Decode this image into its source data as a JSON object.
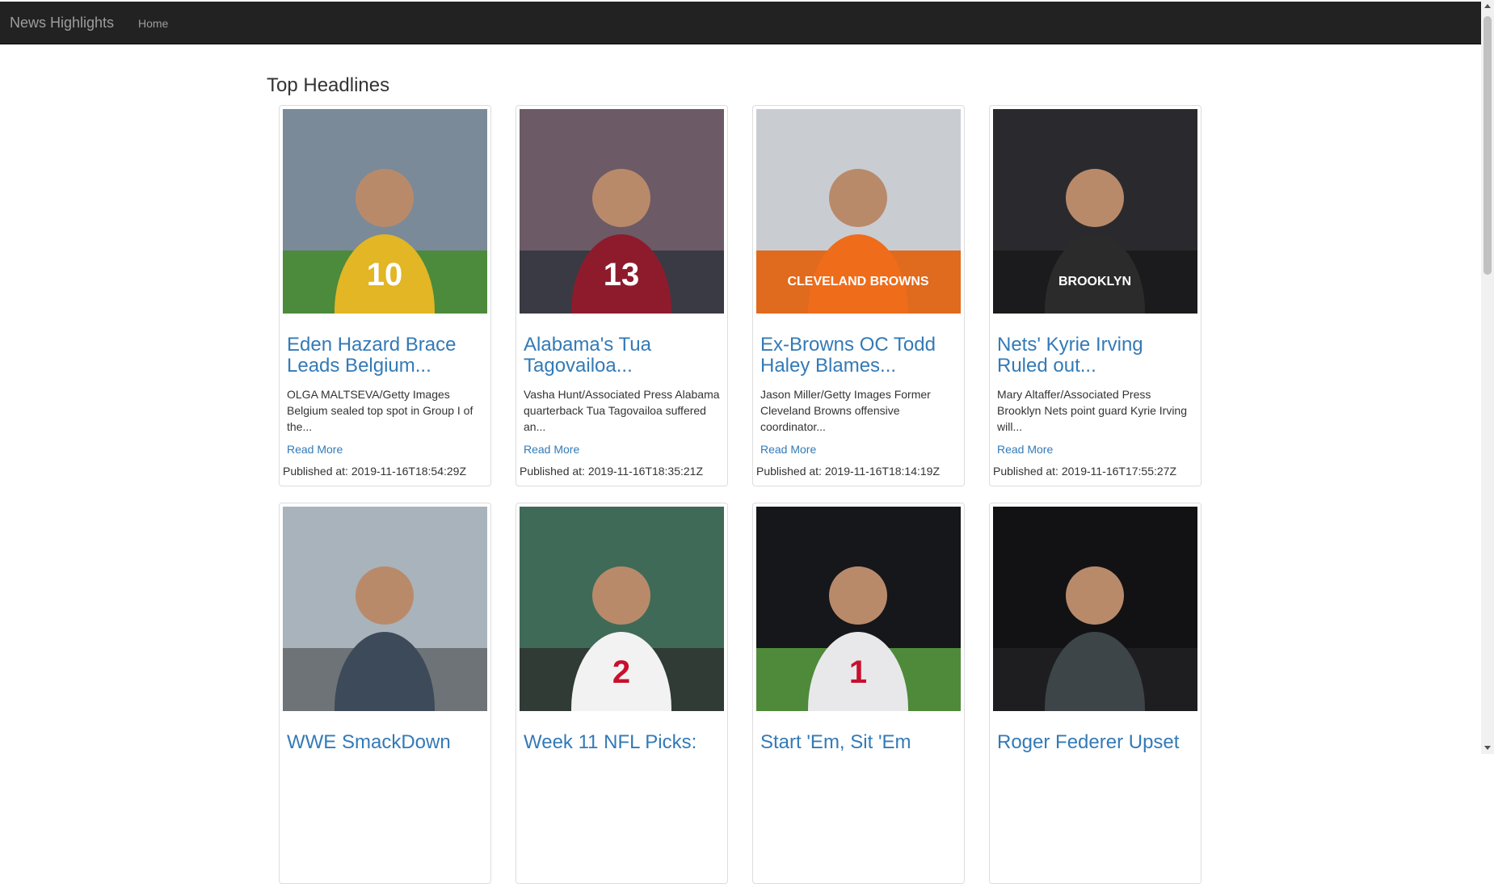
{
  "nav": {
    "brand": "News Highlights",
    "home": "Home"
  },
  "page_title": "Top Headlines",
  "published_prefix": "Published at: ",
  "articles": [
    {
      "title": "Eden Hazard Brace Leads Belgium...",
      "description": "OLGA MALTSEVA/Getty Images Belgium sealed top spot in Group I of the...",
      "read_more": "Read More",
      "published": "Published at: 2019-11-16T18:54:29Z",
      "image": {
        "subject": "soccer-player-yellow-kit",
        "sky": "#7a8a99",
        "ground": "#4c8a3c",
        "shirt": "#e2b624",
        "number": "10"
      }
    },
    {
      "title": "Alabama's Tua Tagovailoa...",
      "description": "Vasha Hunt/Associated Press Alabama quarterback Tua Tagovailoa suffered an...",
      "read_more": "Read More",
      "published": "Published at: 2019-11-16T18:35:21Z",
      "image": {
        "subject": "football-quarterback-crimson",
        "sky": "#6c5a66",
        "ground": "#3a3a44",
        "shirt": "#8e1b2c",
        "number": "13"
      }
    },
    {
      "title": "Ex-Browns OC Todd Haley Blames...",
      "description": "Jason Miller/Getty Images Former Cleveland Browns offensive coordinator...",
      "read_more": "Read More",
      "published": "Published at: 2019-11-16T18:14:19Z",
      "image": {
        "subject": "coach-orange-hoodie",
        "sky": "#c9cdd2",
        "ground": "#e06a1d",
        "shirt": "#ef6c1a",
        "number": "CLEVELAND BROWNS"
      }
    },
    {
      "title": "Nets' Kyrie Irving Ruled out...",
      "description": "Mary Altaffer/Associated Press Brooklyn Nets point guard Kyrie Irving will...",
      "read_more": "Read More",
      "published": "Published at: 2019-11-16T17:55:27Z",
      "image": {
        "subject": "basketball-player-black-shirt",
        "sky": "#2a2a2e",
        "ground": "#1b1b1d",
        "shirt": "#2b2b2b",
        "number": "BROOKLYN"
      }
    },
    {
      "title": "WWE SmackDown",
      "description": "",
      "read_more": "",
      "published": "",
      "image": {
        "subject": "man-at-observation-deck",
        "sky": "#a9b3bb",
        "ground": "#6d7377",
        "shirt": "#3c4a5a",
        "number": ""
      }
    },
    {
      "title": "Week 11 NFL Picks:",
      "description": "",
      "read_more": "",
      "published": "",
      "image": {
        "subject": "football-quarterback-white-jersey",
        "sky": "#3f6a58",
        "ground": "#2f3b34",
        "shirt": "#f2f2f2",
        "number": "2"
      }
    },
    {
      "title": "Start 'Em, Sit 'Em",
      "description": "",
      "read_more": "",
      "published": "",
      "image": {
        "subject": "receiver-catching-ball",
        "sky": "#15171a",
        "ground": "#4e8a3a",
        "shirt": "#e8e8ea",
        "number": "1"
      }
    },
    {
      "title": "Roger Federer Upset",
      "description": "",
      "read_more": "",
      "published": "",
      "image": {
        "subject": "two-tennis-players",
        "sky": "#121214",
        "ground": "#1e1e20",
        "shirt": "#3d4548",
        "number": ""
      }
    }
  ]
}
